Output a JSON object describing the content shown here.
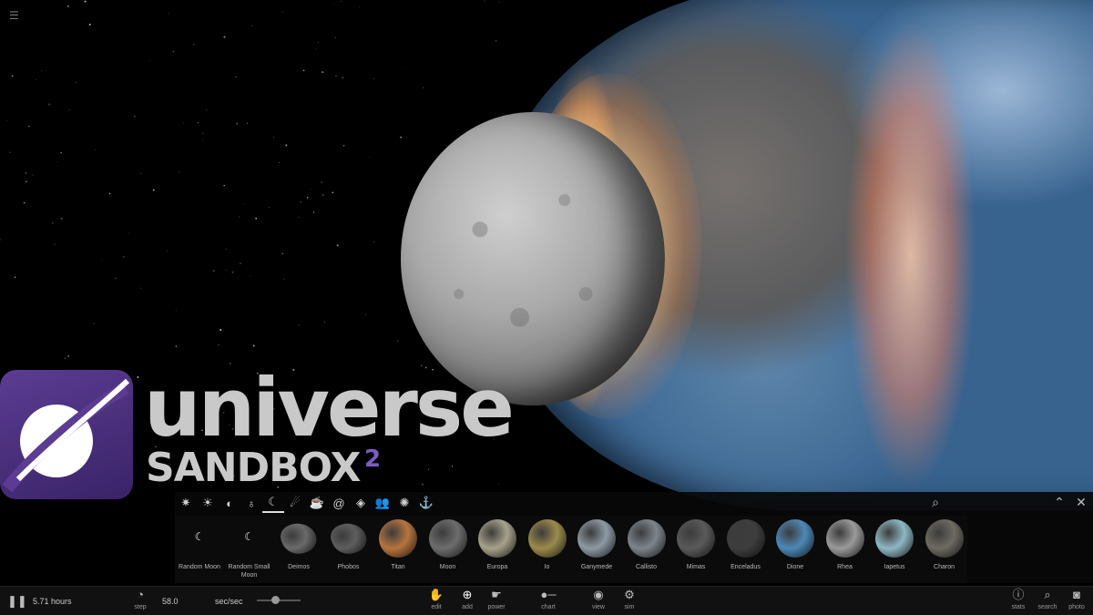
{
  "logo": {
    "word": "universe",
    "sub": "SANDBOX",
    "sup": "2"
  },
  "menu_icon": "hamburger-menu-icon",
  "add_panel": {
    "categories": [
      {
        "icon": "galaxy-icon",
        "glyph": "✷"
      },
      {
        "icon": "star-icon",
        "glyph": "☀"
      },
      {
        "icon": "rocky-planet-icon",
        "glyph": "◐"
      },
      {
        "icon": "ringed-planet-icon",
        "glyph": "♁"
      },
      {
        "icon": "moon-icon",
        "glyph": "☾"
      },
      {
        "icon": "comet-icon",
        "glyph": "☄"
      },
      {
        "icon": "teapot-icon",
        "glyph": "☕"
      },
      {
        "icon": "spiral-galaxy-icon",
        "glyph": "@"
      },
      {
        "icon": "black-hole-icon",
        "glyph": "◈"
      },
      {
        "icon": "people-icon",
        "glyph": "👥"
      },
      {
        "icon": "sun-icon",
        "glyph": "✺"
      },
      {
        "icon": "anchor-icon",
        "glyph": "⚓"
      }
    ],
    "active_category": 4,
    "items": [
      {
        "label": "Random Moon",
        "color": "#000000"
      },
      {
        "label": "Random Small Moon",
        "color": "#000000"
      },
      {
        "label": "Deimos",
        "color": "#6a6a6a"
      },
      {
        "label": "Phobos",
        "color": "#5e5e5e"
      },
      {
        "label": "Titan",
        "color": "#b8743e"
      },
      {
        "label": "Moon",
        "color": "#6d6d6d"
      },
      {
        "label": "Europa",
        "color": "#a6a28a"
      },
      {
        "label": "Io",
        "color": "#9c8a4c"
      },
      {
        "label": "Ganymede",
        "color": "#8e9aa4"
      },
      {
        "label": "Callisto",
        "color": "#7d858c"
      },
      {
        "label": "Mimas",
        "color": "#5a5a5a"
      },
      {
        "label": "Enceladus",
        "color": "#3d3d3d"
      },
      {
        "label": "Dione",
        "color": "#4d88b8"
      },
      {
        "label": "Rhea",
        "color": "#9a9a9a"
      },
      {
        "label": "Iapetus",
        "color": "#8eb8c4"
      },
      {
        "label": "Charon",
        "color": "#6e6a62"
      }
    ]
  },
  "toolbar": {
    "pause_icon": "pause-icon",
    "time": "5.71 hours",
    "step_label": "step",
    "step_value": "58.0",
    "rate_unit": "sec/sec",
    "buttons": [
      {
        "label": "edit",
        "icon": "hand-icon",
        "glyph": "✋"
      },
      {
        "label": "add",
        "icon": "add-circle-icon",
        "glyph": "⊕",
        "active": true
      },
      {
        "label": "power",
        "icon": "power-icon",
        "glyph": "☛"
      },
      {
        "label": "chart",
        "icon": "chart-icon",
        "glyph": "●─"
      },
      {
        "label": "view",
        "icon": "eye-icon",
        "glyph": "◉"
      },
      {
        "label": "sim",
        "icon": "sim-icon",
        "glyph": "⚙"
      }
    ],
    "right_buttons": [
      {
        "label": "stats",
        "icon": "info-icon",
        "glyph": "ⓘ"
      },
      {
        "label": "search",
        "icon": "search-icon",
        "glyph": "⌕"
      },
      {
        "label": "photo",
        "icon": "camera-icon",
        "glyph": "◙"
      }
    ]
  },
  "panel_header": {
    "search_icon": "search-icon",
    "collapse_icon": "chevron-up-icon",
    "close_icon": "close-icon"
  }
}
